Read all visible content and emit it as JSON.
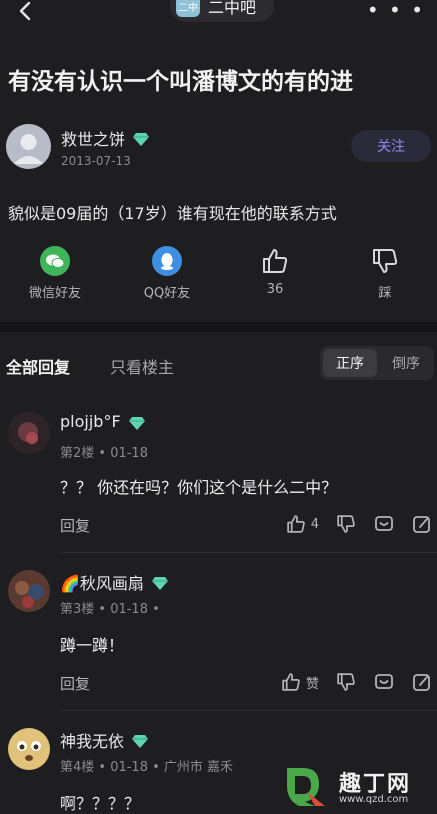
{
  "topbar": {
    "forum_icon_text": "二中",
    "forum_name": "二中吧",
    "more_label": "• • •"
  },
  "post": {
    "title": "有没有认识一个叫潘博文的有的进",
    "author": "救世之饼",
    "date": "2013-07-13",
    "follow_label": "关注",
    "content": "貌似是09届的（17岁）谁有现在他的联系方式",
    "actions": {
      "wechat": "微信好友",
      "qq": "QQ好友",
      "like_count": "36",
      "dislike": "踩"
    }
  },
  "tabs": {
    "all": "全部回复",
    "op_only": "只看楼主",
    "order_asc": "正序",
    "order_desc": "倒序"
  },
  "replies": [
    {
      "name": "plojjb°F",
      "meta": "第2楼 • 01-18",
      "text": "？？ 你还在吗？你们这个是什么二中？",
      "reply_label": "回复",
      "like_count": "4"
    },
    {
      "name": "🌈秋风画扇",
      "meta": "第3楼 • 01-18 •",
      "text": "蹲一蹲！",
      "reply_label": "回复",
      "like_count": "赞"
    },
    {
      "name": "神我无依",
      "meta": "第4楼 • 01-18 • 广州市 嘉禾",
      "text": "啊？？？？"
    }
  ],
  "watermark": {
    "name": "趣丁网",
    "url": "www.qzd.com"
  },
  "colors": {
    "background": "#1e1e20",
    "accent": "#8f87f2",
    "diamond": "#5fd4b0",
    "wechat": "#3fb55a",
    "qq": "#3e8fe0"
  }
}
